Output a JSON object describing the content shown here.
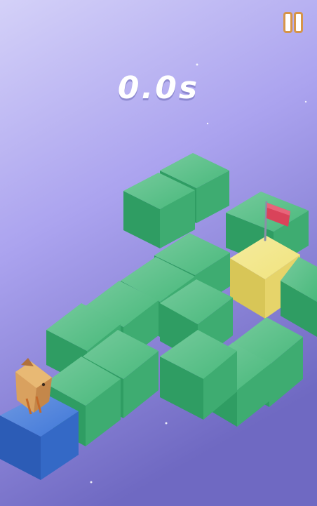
{
  "hud": {
    "timer": "0.0s"
  },
  "colors": {
    "bg_top": "#d4d1f8",
    "bg_mid": "#aba3ef",
    "bg_bottom": "#6f69c2",
    "tile_top": "#49b97c",
    "tile_left": "#2f9d63",
    "tile_right": "#3eac71",
    "goal_top": "#f1e47e",
    "goal_left": "#d8c657",
    "goal_right": "#e6d46a",
    "start_top": "#3f77d8",
    "start_left": "#2c5cb6",
    "start_right": "#3469c6",
    "flag": "#d9435a",
    "pause_outline": "#d6954a"
  },
  "icons": {
    "pause": "pause-icon",
    "flag": "goal-flag-icon",
    "player": "bird-character-icon"
  }
}
